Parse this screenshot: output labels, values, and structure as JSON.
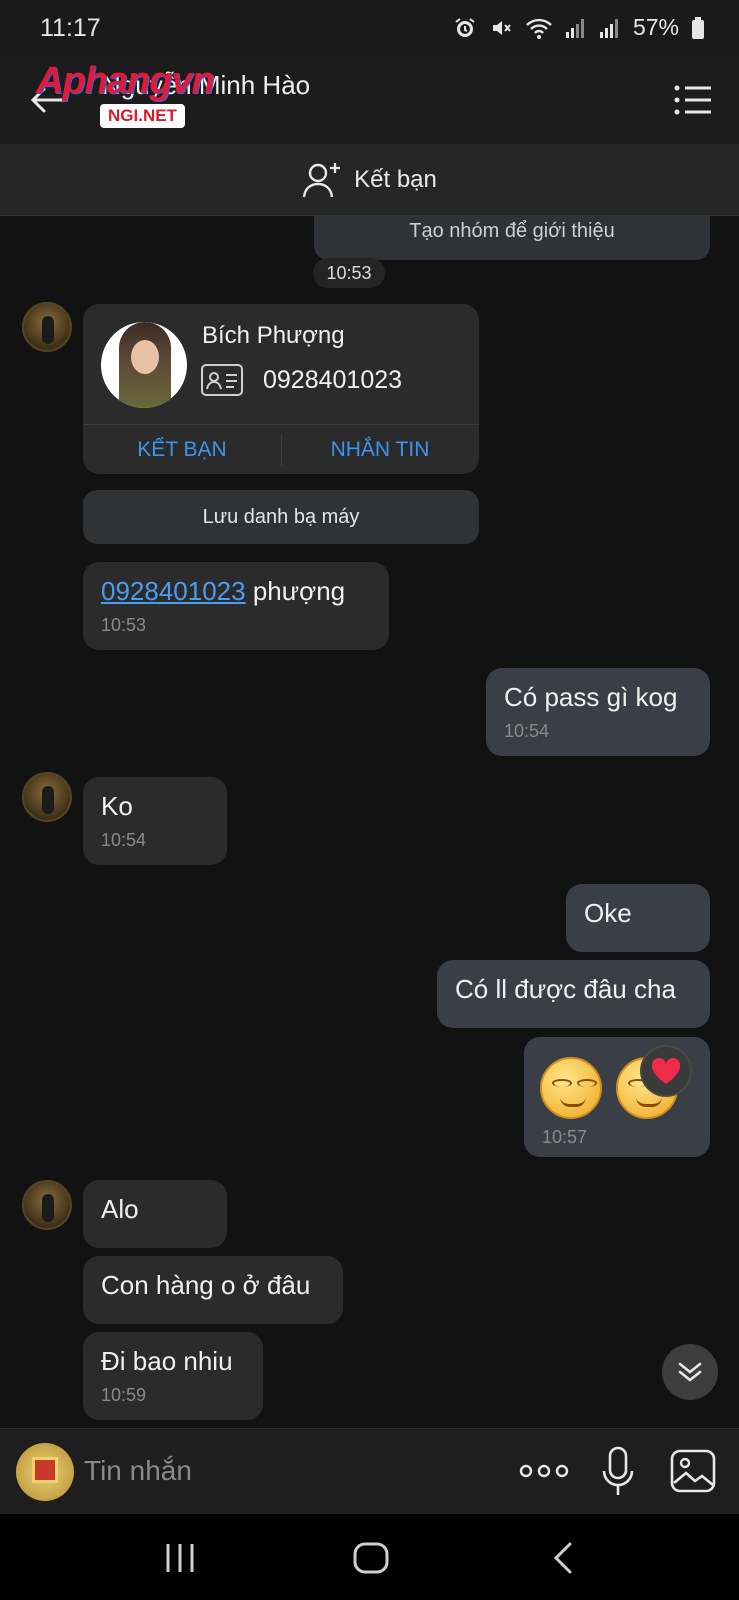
{
  "status_bar": {
    "time": "11:17",
    "battery": "57%",
    "icons": [
      "alarm-icon",
      "mute-icon",
      "wifi-icon",
      "signal-icon",
      "signal-icon",
      "battery-icon"
    ]
  },
  "header": {
    "contact_name": "Nguyễn Minh Hào",
    "watermark_text": "Aphangvn",
    "watermark_badge": "NGI.NET"
  },
  "add_friend_bar": {
    "label": "Kết bạn"
  },
  "chat": {
    "partial_message": "Tạo nhóm để giới thiệu",
    "time_pill": "10:53",
    "contact_card": {
      "name": "Bích Phượng",
      "phone": "0928401023",
      "add_friend_label": "KẾT BẠN",
      "message_label": "NHẮN TIN",
      "save_contact_label": "Lưu danh bạ máy"
    },
    "messages": [
      {
        "direction": "in",
        "text_link": "0928401023",
        "text": " phượng",
        "time": "10:53"
      },
      {
        "direction": "out",
        "text": "Có pass gì kog",
        "time": "10:54"
      },
      {
        "direction": "in",
        "text": "Ko",
        "time": "10:54"
      },
      {
        "direction": "out",
        "text": "Oke"
      },
      {
        "direction": "out",
        "text": "Có ll được đâu cha"
      },
      {
        "direction": "out",
        "type": "emoji",
        "time": "10:57"
      },
      {
        "direction": "in",
        "text": "Alo"
      },
      {
        "direction": "in",
        "text": "Con hàng o ở đâu"
      },
      {
        "direction": "in",
        "text": "Đi bao nhiu",
        "time": "10:59"
      }
    ]
  },
  "input_bar": {
    "placeholder": "Tin nhắn"
  },
  "colors": {
    "background": "#121212",
    "bubble_in": "#2b2b2b",
    "bubble_out": "#3a3f47",
    "link": "#4a9df2",
    "accent_blue": "#3d94f0"
  }
}
